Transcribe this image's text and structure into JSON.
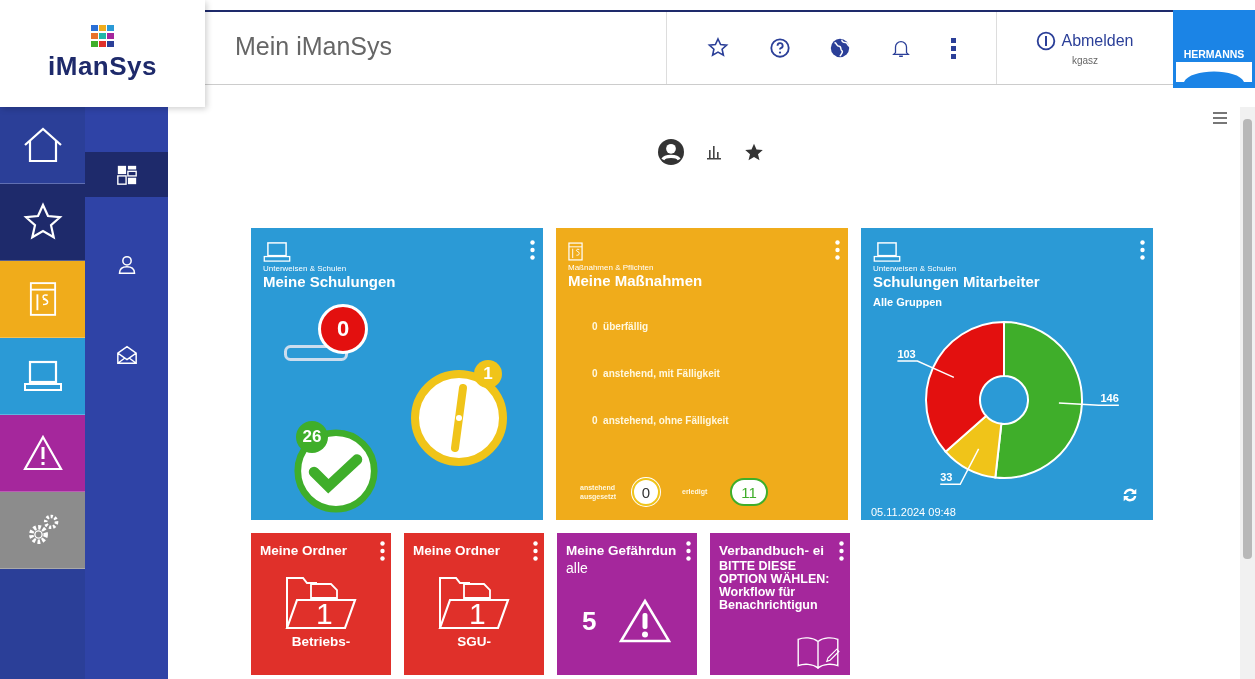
{
  "logo": {
    "name": "iManSys"
  },
  "header": {
    "title": "Mein iManSys",
    "logout": "Abmelden",
    "user": "kgasz",
    "brand": "HERMANNS"
  },
  "main_nav": [
    {
      "color": "#2b3f98"
    },
    {
      "color": "#1e2a6b"
    },
    {
      "color": "#f0ac1b"
    },
    {
      "color": "#2b9ad6"
    },
    {
      "color": "#a5279c"
    },
    {
      "color": "#8c8c8c"
    }
  ],
  "sub_nav": [
    {
      "selected": true
    },
    {
      "selected": false
    },
    {
      "selected": false
    }
  ],
  "schulungen_card": {
    "category": "Unterweisen & Schulen",
    "title": "Meine Schulungen",
    "overdue": "0",
    "pending": "1",
    "done": "26"
  },
  "massnahmen_card": {
    "category": "Maßnahmen & Pflichten",
    "title": "Meine Maßnahmen",
    "rows": [
      {
        "count": "0",
        "label": "überfällig"
      },
      {
        "count": "0",
        "label": "anstehend, mit Fälligkeit"
      },
      {
        "count": "0",
        "label": "anstehend, ohne Fälligkeit"
      }
    ],
    "suspended_label": "anstehend ausgesetzt",
    "suspended": "0",
    "done_label": "erledigt",
    "done": "11"
  },
  "mitarbeiter_card": {
    "category": "Unterweisen & Schulen",
    "title": "Schulungen Mitarbeiter",
    "group": "Alle Gruppen",
    "timestamp": "05.11.2024 09:48",
    "chart_data": {
      "type": "donut",
      "values": [
        146,
        33,
        103
      ],
      "colors": [
        "#3fae2a",
        "#f0c419",
        "#e3100f"
      ],
      "data_labels": true
    }
  },
  "tiles": [
    {
      "kind": "folder",
      "color": "#e0302a",
      "title": "Meine Ordner",
      "count": "1",
      "caption": "Betriebs-"
    },
    {
      "kind": "folder",
      "color": "#e0302a",
      "title": "Meine Ordner",
      "count": "1",
      "caption": "SGU-"
    },
    {
      "kind": "hazard",
      "color": "#a5279c",
      "title": "Meine Gefährdun",
      "subtitle": "alle",
      "count": "5"
    },
    {
      "kind": "book",
      "color": "#a5279c",
      "title": "Verbandbuch- ei",
      "subtitle": "BITTE DIESE OPTION WÄHLEN: Workflow für Benachrichtigun"
    }
  ]
}
